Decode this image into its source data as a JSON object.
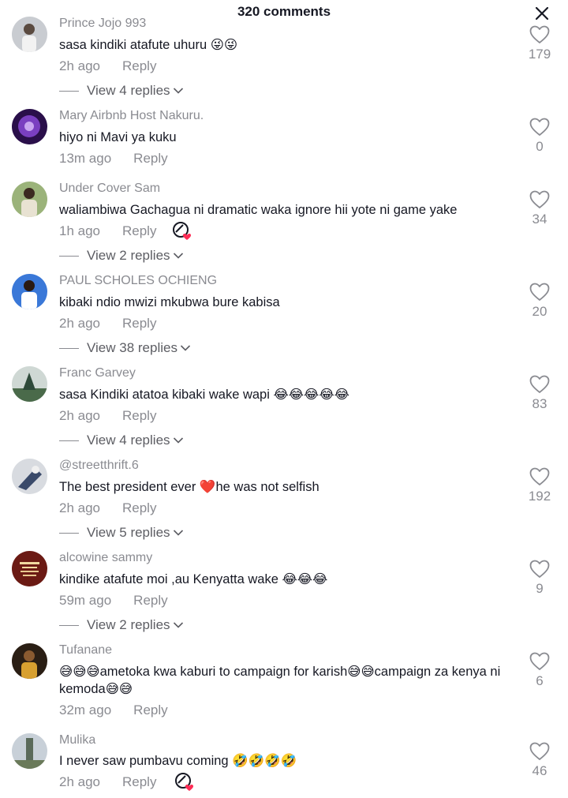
{
  "header": {
    "title": "320 comments"
  },
  "comments": [
    {
      "username": "Prince Jojo 993",
      "text": "sasa kindiki atafute uhuru 😜😜",
      "time": "2h ago",
      "reply": "Reply",
      "likes": "179",
      "view_replies": "View 4 replies",
      "avatar_color": "#8c8f94"
    },
    {
      "username": "Mary Airbnb Host Nakuru.",
      "text": "hiyo ni Mavi ya kuku",
      "time": "13m ago",
      "reply": "Reply",
      "likes": "0",
      "view_replies": "",
      "avatar_color": "#5a2a8a"
    },
    {
      "username": "Under Cover Sam",
      "text": "waliambiwa Gachagua ni dramatic waka ignore hii yote ni game yake",
      "time": "1h ago",
      "reply": "Reply",
      "likes": "34",
      "view_replies": "View 2 replies",
      "avatar_color": "#6f8a4a"
    },
    {
      "username": "PAUL SCHOLES OCHIENG",
      "text": "kibaki ndio mwizi mkubwa bure kabisa",
      "time": "2h ago",
      "reply": "Reply",
      "likes": "20",
      "view_replies": "View 38 replies",
      "avatar_color": "#2b5fb8"
    },
    {
      "username": "Franc Garvey",
      "text": "sasa Kindiki atatoa kibaki wake wapi 😂😂😂😂😂",
      "time": "2h ago",
      "reply": "Reply",
      "likes": "83",
      "view_replies": "View 4 replies",
      "avatar_color": "#5e7a6a"
    },
    {
      "username": "@streetthrift.6",
      "text": "The best president ever ❤️he was not selfish",
      "time": "2h ago",
      "reply": "Reply",
      "likes": "192",
      "view_replies": "View 5 replies",
      "avatar_color": "#9aa0a8"
    },
    {
      "username": "alcowine sammy",
      "text": "kindike atafute moi ,au Kenyatta wake 😂😂😂",
      "time": "59m ago",
      "reply": "Reply",
      "likes": "9",
      "view_replies": "View 2 replies",
      "avatar_color": "#6b1a14"
    },
    {
      "username": "Tufanane",
      "text": "😅😅😅ametoka kwa kaburi to campaign for karish😅😅campaign za kenya ni kemoda😅😅",
      "time": "32m ago",
      "reply": "Reply",
      "likes": "6",
      "view_replies": "",
      "avatar_color": "#3a2a1a"
    },
    {
      "username": "Mulika",
      "text": "I never saw pumbavu coming 🤣🤣🤣🤣",
      "time": "2h ago",
      "reply": "Reply",
      "likes": "46",
      "view_replies": "",
      "avatar_color": "#7a8a70"
    }
  ],
  "colors": {
    "text": "#161823",
    "secondary": "#8a8b91",
    "creator_heart": "#fe2c55"
  }
}
